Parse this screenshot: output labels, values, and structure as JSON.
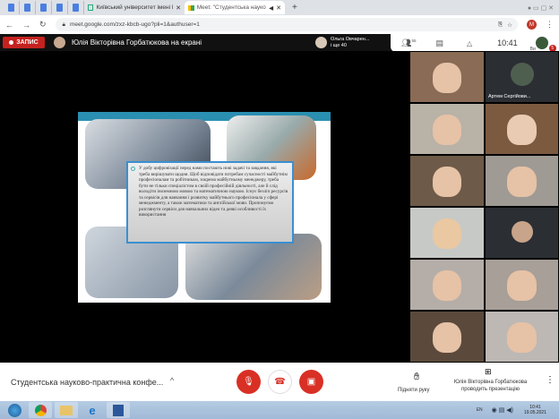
{
  "browser": {
    "tabs": [
      {
        "label": "Київський університет імені Бор"
      },
      {
        "label": "Meet: \"Студентська науково"
      }
    ],
    "url": "meet.google.com/zxz-kbcb-ugo?pli=1&authuser=1",
    "profile": "M"
  },
  "meet": {
    "record_label": "ЗАПИС",
    "presenter_text": "Юлія Вікторівна Горбатюкова на екрані",
    "others_name": "Ольга Овчарен...",
    "others_count": "і ще 40",
    "participants_count": "55",
    "clock": "10:41",
    "you_label": "Ви",
    "notif": "5",
    "slide_text": "У добу цифровізації перед нами постають нові задачі та завдання, які треба вирішувати щодня. Щоб відповідати потребам сучасності майбутнім професіоналам та робітникам, зокрема майбутньому менеджеру, треба бути не тільки спеціалістом в своїй професійній діяльності, але й слід володіти іноземною мовою та математичною наукою. Існує безліч ресурсів та сервісів для навчання і розвитку майбутнього професіонала у сфері менеджменту, а також математики та англійської мови. Пропонуємо розглянути сервіси для навчальних відео та деякі особливості їх використання",
    "tiles": [
      {
        "name": ""
      },
      {
        "name": "Артем Сергійови..."
      },
      {
        "name": ""
      },
      {
        "name": ""
      },
      {
        "name": ""
      },
      {
        "name": ""
      },
      {
        "name": ""
      },
      {
        "name": ""
      },
      {
        "name": ""
      },
      {
        "name": ""
      },
      {
        "name": ""
      },
      {
        "name": ""
      }
    ],
    "meeting_title": "Студентська науково-практична конфе...",
    "raise_hand": "Підняти руку",
    "presenting_line1": "Юлія Вікторівна Горбатюкова",
    "presenting_line2": "проводить презентацію"
  },
  "taskbar": {
    "lang": "EN",
    "time": "10:41",
    "date": "19.05.2021"
  },
  "colors": {
    "record": "#c5221f",
    "controls": "#d93025"
  }
}
